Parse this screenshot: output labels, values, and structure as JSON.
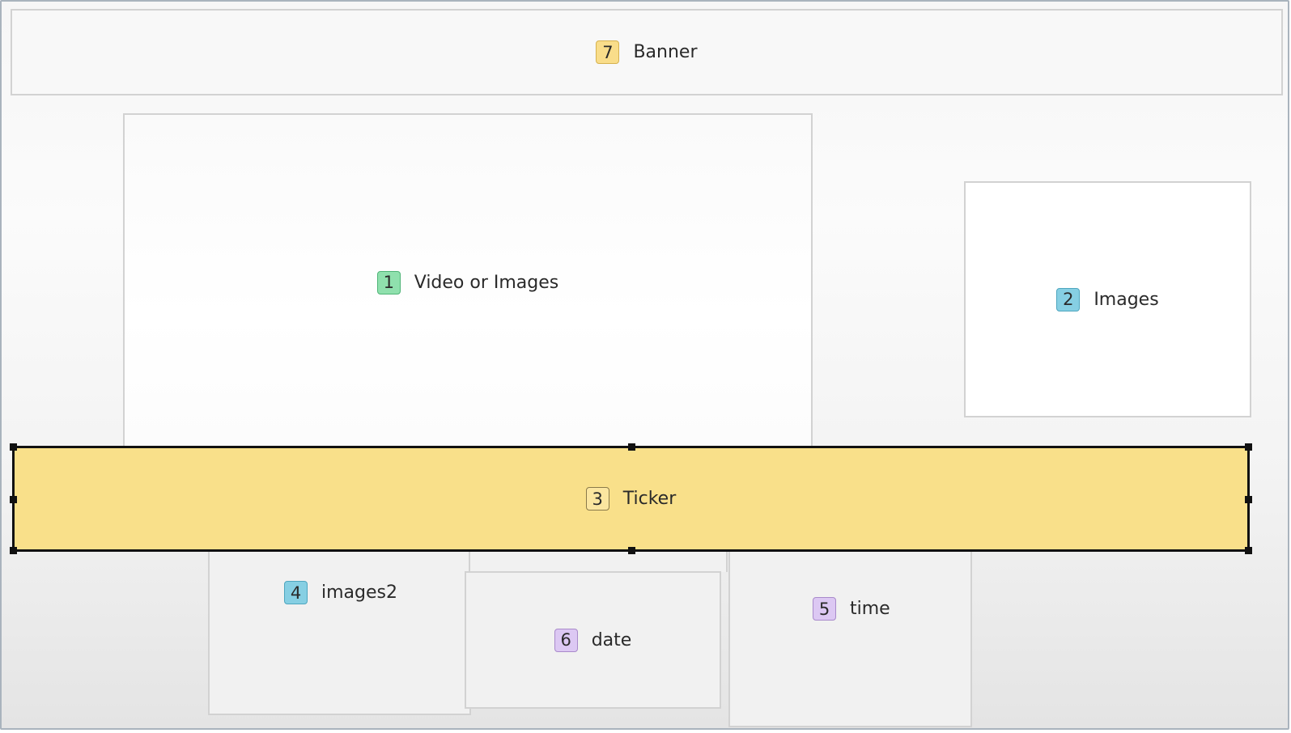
{
  "zones": {
    "banner": {
      "number": "7",
      "label": "Banner",
      "badge_bg": "#f9dd8a",
      "badge_border": "#d6b24f"
    },
    "video": {
      "number": "1",
      "label": "Video or Images",
      "badge_bg": "#8fe0ad",
      "badge_border": "#4fb477"
    },
    "images": {
      "number": "2",
      "label": "Images",
      "badge_bg": "#86cfe3",
      "badge_border": "#4ea6bf"
    },
    "ticker": {
      "number": "3",
      "label": "Ticker",
      "badge_bg": "#fbe6a0",
      "badge_border": "#8a7a4a",
      "selected": true
    },
    "images2": {
      "number": "4",
      "label": "images2",
      "badge_bg": "#86cfe3",
      "badge_border": "#4ea6bf"
    },
    "time": {
      "number": "5",
      "label": "time",
      "badge_bg": "#dcc8f3",
      "badge_border": "#a98acb"
    },
    "date": {
      "number": "6",
      "label": "date",
      "badge_bg": "#dcc8f3",
      "badge_border": "#a98acb"
    }
  },
  "colors": {
    "selection_border": "#111111",
    "ticker_fill": "#f9e08a",
    "zone_border": "#d2d2d2"
  }
}
